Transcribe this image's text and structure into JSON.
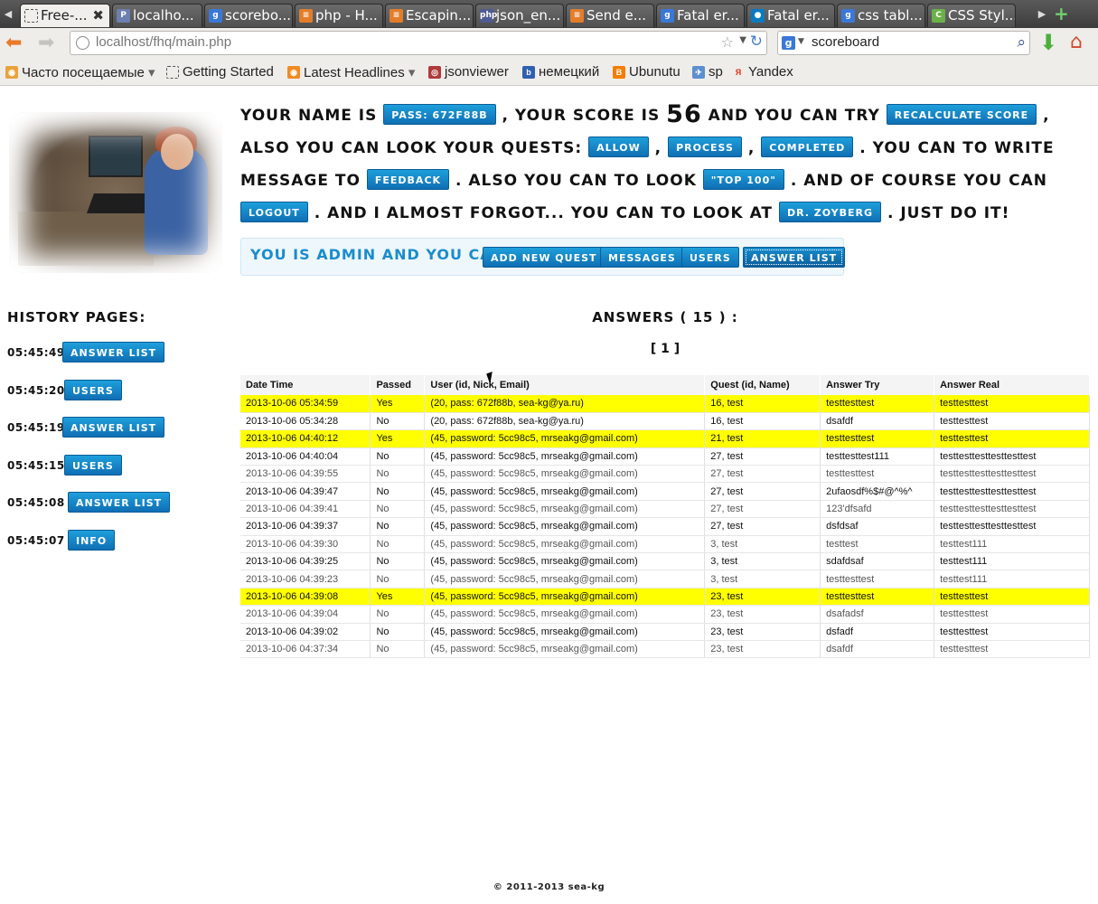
{
  "browser": {
    "tabs": [
      {
        "label": "Free-...",
        "icon": "dotted-page-icon",
        "active": true
      },
      {
        "label": "localho...",
        "icon": "pma-icon"
      },
      {
        "label": "scorebo...",
        "icon": "google-icon"
      },
      {
        "label": "php - H...",
        "icon": "stackoverflow-icon"
      },
      {
        "label": "Escapin...",
        "icon": "stackoverflow-icon"
      },
      {
        "label": "json_en...",
        "icon": "php-icon"
      },
      {
        "label": "Send e...",
        "icon": "stackoverflow-icon"
      },
      {
        "label": "Fatal er...",
        "icon": "google-icon"
      },
      {
        "label": "Fatal er...",
        "icon": "drupal-icon"
      },
      {
        "label": "css tabl...",
        "icon": "google-icon"
      },
      {
        "label": "CSS Styl...",
        "icon": "css-icon"
      }
    ],
    "url": "localhost/fhq/main.php",
    "search": "scoreboard",
    "bookmarks": [
      {
        "label": "Часто посещаемые",
        "icon": "rss-folder-icon",
        "dropdown": true
      },
      {
        "label": "Getting Started",
        "icon": "dotted-page-icon"
      },
      {
        "label": "Latest Headlines",
        "icon": "rss-icon",
        "dropdown": true
      },
      {
        "label": "jsonviewer",
        "icon": "jsonviewer-icon"
      },
      {
        "label": "немецкий",
        "icon": "b-icon"
      },
      {
        "label": "Ubunutu",
        "icon": "blogger-icon"
      },
      {
        "label": "sp",
        "icon": "sp-icon"
      },
      {
        "label": "Yandex",
        "icon": "yandex-icon"
      }
    ]
  },
  "intro": {
    "t1": "your name is",
    "name_btn": "pass: 672f88b",
    "t2": ", your score is",
    "score": "56",
    "t3": "and you can try",
    "recalc_btn": "recalculate score",
    "t4": ", also you can look your quests:",
    "allow_btn": "allow",
    "t5": ",",
    "process_btn": "process",
    "t6": ",",
    "completed_btn": "completed",
    "t7": ". you can to write message to",
    "feedback_btn": "feedback",
    "t8": ". also you can to look",
    "top100_btn": "\"top 100\"",
    "t9": ". and of course you can",
    "logout_btn": "logout",
    "t10": ". and i almost forgot... you can to look at",
    "zoyberg_btn": "dr. zoyberg",
    "t11": ". just do it!"
  },
  "admin": {
    "label": "You is admin and you can:",
    "buttons": [
      "add new quest",
      "messages",
      "users",
      "answer list"
    ]
  },
  "history": {
    "title": "History pages:",
    "items": [
      {
        "time": "05:45:49",
        "label": "answer list"
      },
      {
        "time": "05:45:20",
        "label": "users"
      },
      {
        "time": "05:45:19",
        "label": "answer list"
      },
      {
        "time": "05:45:15",
        "label": "users"
      },
      {
        "time": "05:45:08",
        "label": "answer list"
      },
      {
        "time": "05:45:07",
        "label": "info"
      }
    ]
  },
  "answers": {
    "title": "Answers ( 15 ) :",
    "pager": "[ 1 ]",
    "headers": [
      "Date Time",
      "Passed",
      "User (id, Nick, Email)",
      "Quest (id, Name)",
      "Answer Try",
      "Answer Real"
    ],
    "rows": [
      [
        "2013-10-06 05:34:59",
        "Yes",
        "(20, pass: 672f88b, sea-kg@ya.ru)",
        "16, test",
        "testtesttest",
        "testtesttest"
      ],
      [
        "2013-10-06 05:34:28",
        "No",
        "(20, pass: 672f88b, sea-kg@ya.ru)",
        "16, test",
        "dsafdf",
        "testtesttest"
      ],
      [
        "2013-10-06 04:40:12",
        "Yes",
        "(45, password: 5cc98c5, mrseakg@gmail.com)",
        "21, test",
        "testtesttest",
        "testtesttest"
      ],
      [
        "2013-10-06 04:40:04",
        "No",
        "(45, password: 5cc98c5, mrseakg@gmail.com)",
        "27, test",
        "testtesttest111",
        "testtesttesttesttesttest"
      ],
      [
        "2013-10-06 04:39:55",
        "No",
        "(45, password: 5cc98c5, mrseakg@gmail.com)",
        "27, test",
        "testtesttest",
        "testtesttesttesttesttest"
      ],
      [
        "2013-10-06 04:39:47",
        "No",
        "(45, password: 5cc98c5, mrseakg@gmail.com)",
        "27, test",
        "2ufaosdf%$#@^%^",
        "testtesttesttesttesttest"
      ],
      [
        "2013-10-06 04:39:41",
        "No",
        "(45, password: 5cc98c5, mrseakg@gmail.com)",
        "27, test",
        "123'dfsafd",
        "testtesttesttesttesttest"
      ],
      [
        "2013-10-06 04:39:37",
        "No",
        "(45, password: 5cc98c5, mrseakg@gmail.com)",
        "27, test",
        "dsfdsaf",
        "testtesttesttesttesttest"
      ],
      [
        "2013-10-06 04:39:30",
        "No",
        "(45, password: 5cc98c5, mrseakg@gmail.com)",
        "3, test",
        "testtest",
        "testtest111"
      ],
      [
        "2013-10-06 04:39:25",
        "No",
        "(45, password: 5cc98c5, mrseakg@gmail.com)",
        "3, test",
        "sdafdsaf",
        "testtest111"
      ],
      [
        "2013-10-06 04:39:23",
        "No",
        "(45, password: 5cc98c5, mrseakg@gmail.com)",
        "3, test",
        "testtesttest",
        "testtest111"
      ],
      [
        "2013-10-06 04:39:08",
        "Yes",
        "(45, password: 5cc98c5, mrseakg@gmail.com)",
        "23, test",
        "testtesttest",
        "testtesttest"
      ],
      [
        "2013-10-06 04:39:04",
        "No",
        "(45, password: 5cc98c5, mrseakg@gmail.com)",
        "23, test",
        "dsafadsf",
        "testtesttest"
      ],
      [
        "2013-10-06 04:39:02",
        "No",
        "(45, password: 5cc98c5, mrseakg@gmail.com)",
        "23, test",
        "dsfadf",
        "testtesttest"
      ],
      [
        "2013-10-06 04:37:34",
        "No",
        "(45, password: 5cc98c5, mrseakg@gmail.com)",
        "23, test",
        "dsafdf",
        "testtesttest"
      ]
    ]
  },
  "footer": "© 2011-2013 sea-kg",
  "colors": {
    "accent": "#1a8dcc",
    "button": "#1283c6",
    "highlight": "#ffff00",
    "quest": "#d9261c"
  }
}
